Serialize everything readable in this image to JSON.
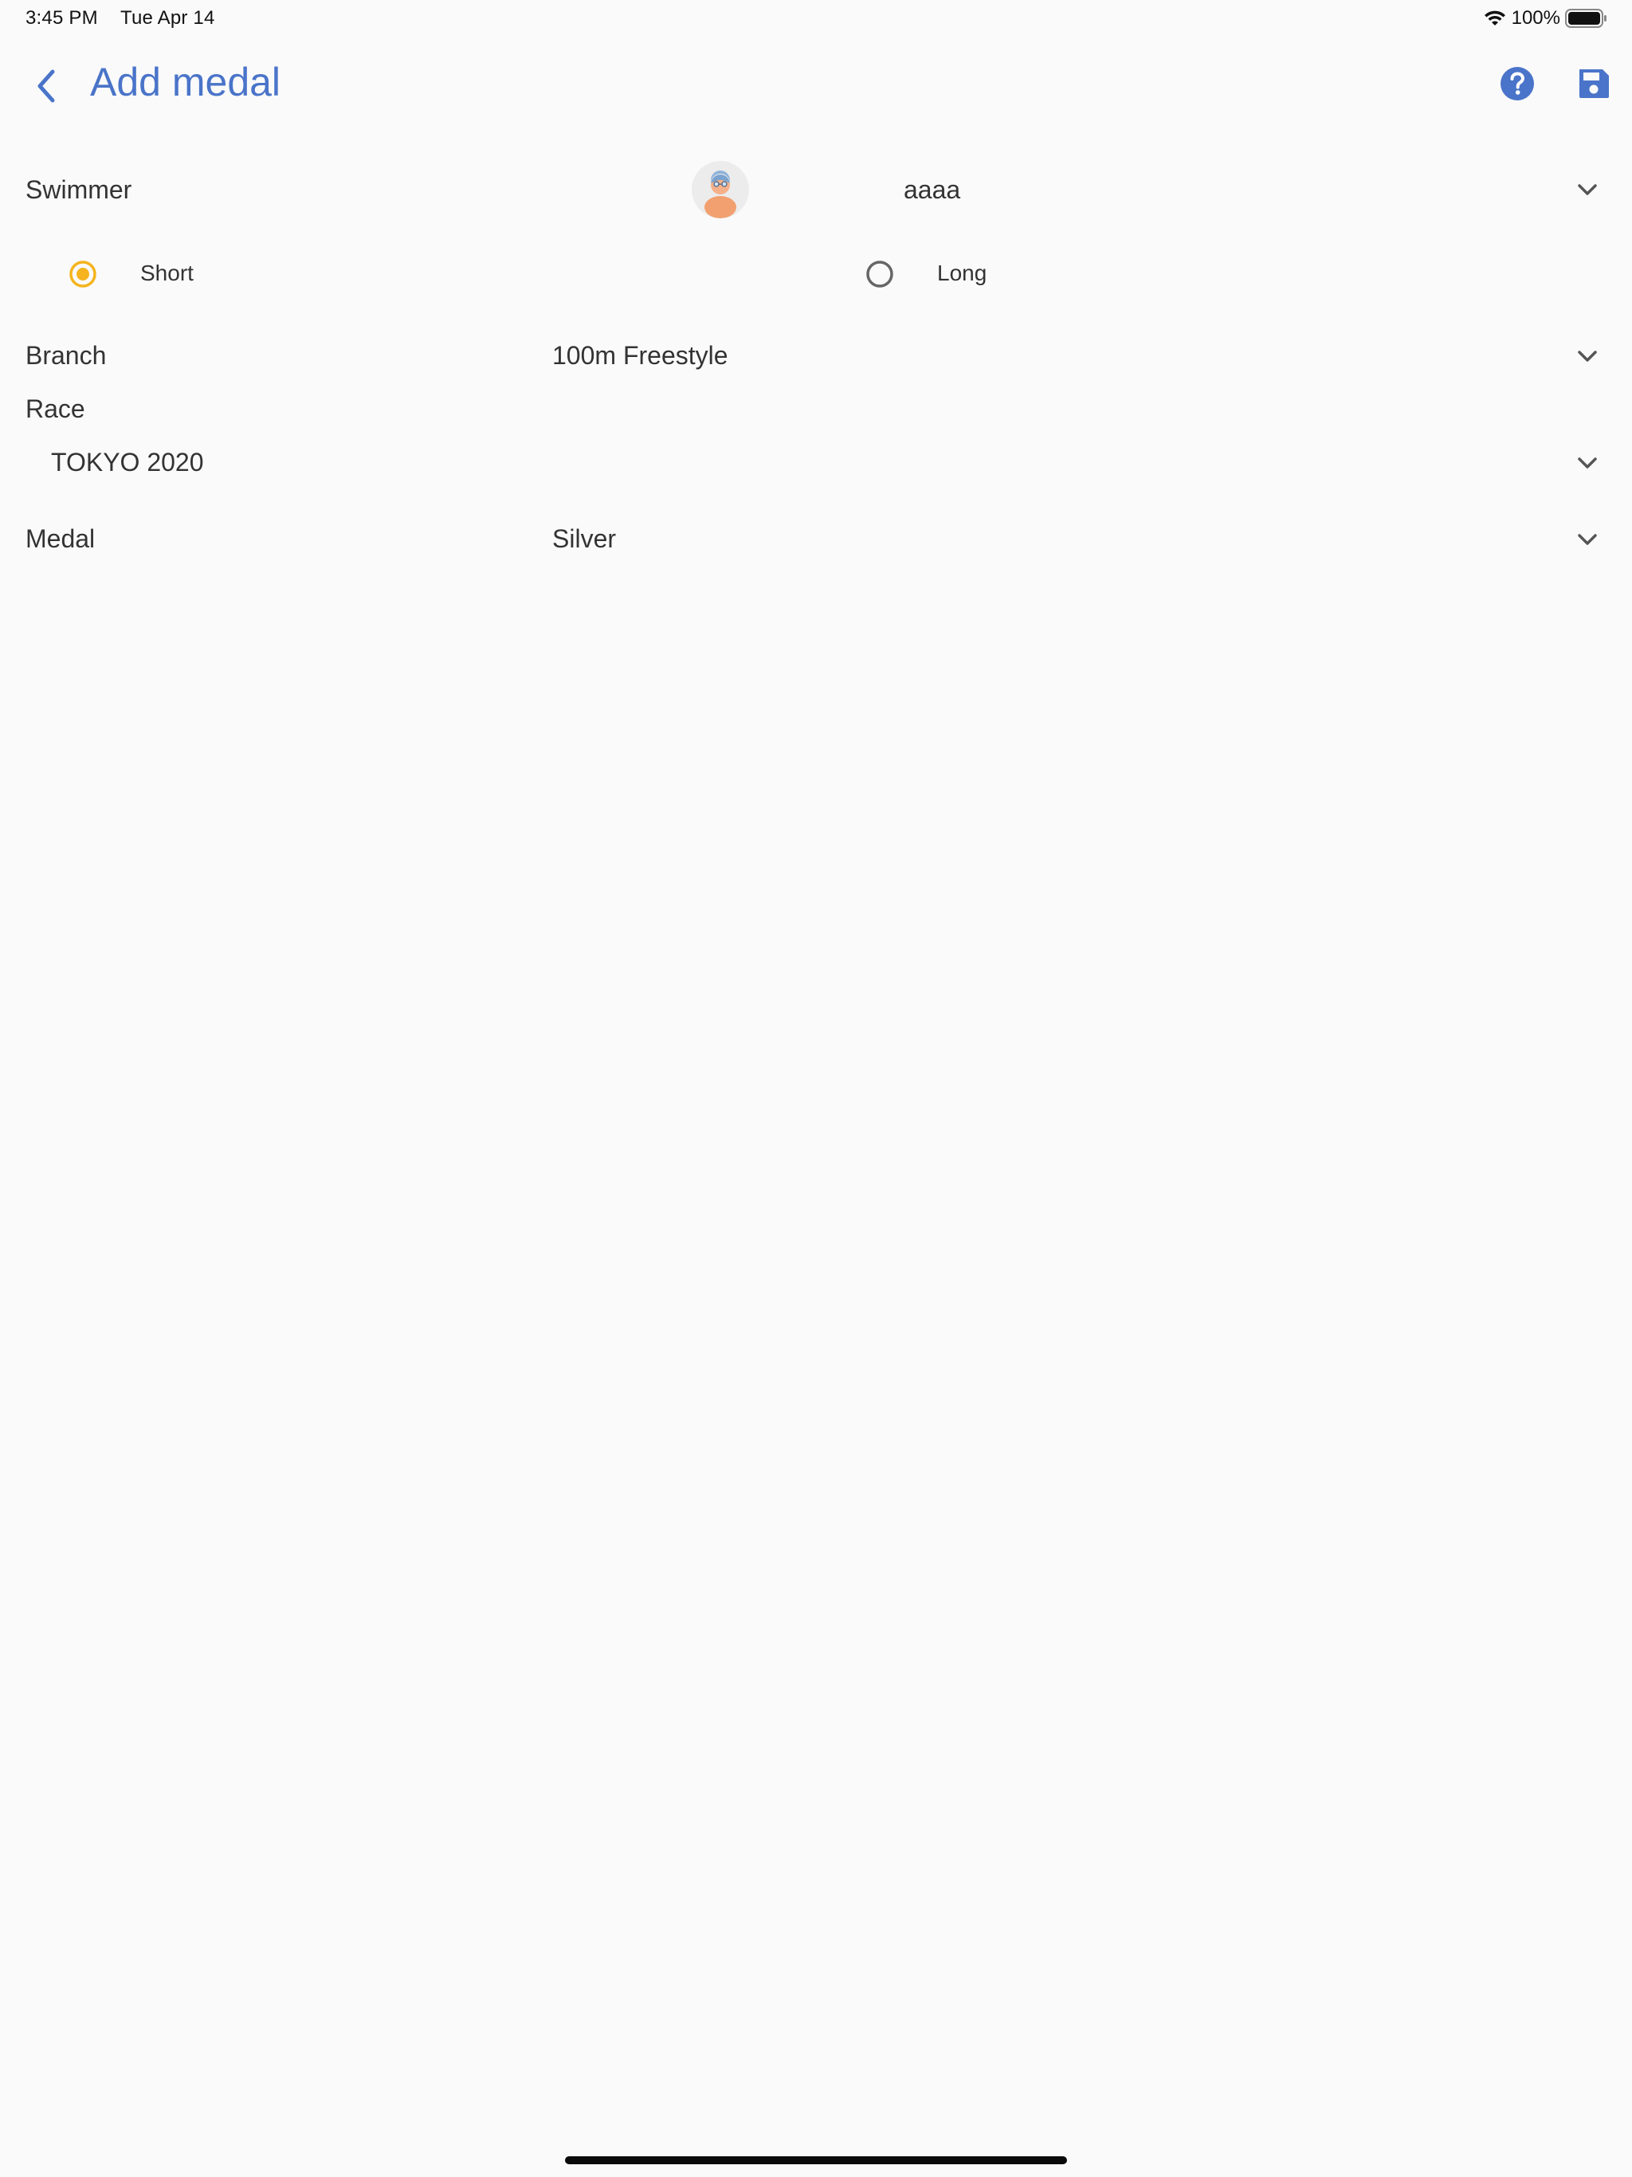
{
  "status_bar": {
    "time": "3:45 PM",
    "date": "Tue Apr 14",
    "battery": "100%",
    "icons": [
      "wifi-icon",
      "battery-icon"
    ]
  },
  "app_bar": {
    "title": "Add medal",
    "accent_color": "#4a74c9",
    "icons": [
      "back-arrow-icon",
      "help-icon",
      "save-icon"
    ]
  },
  "form": {
    "swimmer": {
      "label": "Swimmer",
      "value": "aaaa",
      "avatar_icon": "swimmer-avatar-icon"
    },
    "pool_length": {
      "options": [
        {
          "label": "Short",
          "selected": true
        },
        {
          "label": "Long",
          "selected": false
        }
      ],
      "selected_color": "#f5b41e"
    },
    "branch": {
      "label": "Branch",
      "value": "100m Freestyle"
    },
    "race": {
      "label": "Race",
      "value": "TOKYO 2020"
    },
    "medal": {
      "label": "Medal",
      "value": "Silver"
    }
  }
}
